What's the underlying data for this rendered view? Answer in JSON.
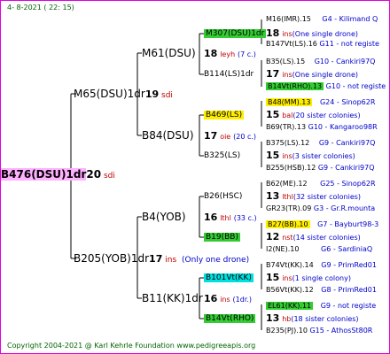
{
  "date": "4-  8-2021  ( 22:  15)",
  "copyright": "Copyright 2004-2021 @ Karl Kehrle Foundation   www.pedigreeapis.org",
  "root": {
    "label": "B476(DSU)1dr",
    "year": "20",
    "note": "sdi"
  },
  "gen1": [
    {
      "label": "M65(DSU)1dr",
      "year": "19",
      "note": "sdi"
    },
    {
      "label": "B205(YOB)1dr",
      "year": "17",
      "note": "ins",
      "extra": "(Only one drone)"
    }
  ],
  "gen2": [
    {
      "label": "M61(DSU)",
      "year": "18",
      "note": "leyh",
      "extra": "(7 c.)"
    },
    {
      "label": "B84(DSU)",
      "year": "17",
      "note": "oie",
      "extra": "(20 c.)"
    },
    {
      "label": "B4(YOB)",
      "year": "16",
      "note": "lthl",
      "extra": "(33 c.)"
    },
    {
      "label": "B11(KK)1dr",
      "year": "16",
      "note": "ins",
      "extra": "(1dr.)"
    }
  ],
  "gen3": [
    {
      "label": "M307(DSU)1dr",
      "year": "18",
      "note": "ins",
      "extra": "(One single drone)"
    },
    {
      "label": "B114(LS)1dr",
      "year": "17",
      "note": "ins",
      "extra": "(One single drone)"
    },
    {
      "label": "B469(LS)",
      "year": "15",
      "note": "bal",
      "extra": "(20 sister colonies)"
    },
    {
      "label": "B325(LS)",
      "year": "15",
      "note": "ins",
      "extra": "(3 sister colonies)"
    },
    {
      "label": "B26(HSC)",
      "year": "13",
      "note": "lthl",
      "extra": "(32 sister colonies)"
    },
    {
      "label": "B19(BB)",
      "year": "12",
      "note": "nst",
      "extra": "(14 sister colonies)"
    },
    {
      "label": "B101Vt(KK)",
      "year": "15",
      "note": "ins",
      "extra": "(1 single colony)"
    },
    {
      "label": "B14Vt(RHO)",
      "year": "13",
      "note": "hb",
      "extra": "(18 sister colonies)"
    }
  ],
  "gen4": [
    {
      "label": "M16(IMR).15",
      "ref": "G4 - Kilimand Q"
    },
    {
      "label": "B147Vt(LS).16",
      "ref": "G11 - not registe"
    },
    {
      "label": "B35(LS).15",
      "ref": "G10 - Cankiri97Q"
    },
    {
      "label": "B14Vt(RHO).13",
      "ref": "G10 - not registe"
    },
    {
      "label": "B48(MM).13",
      "ref": "G24 - Sinop62R"
    },
    {
      "label": "B69(TR).13",
      "ref": "G10 - Kangaroo98R"
    },
    {
      "label": "B375(LS).12",
      "ref": "G9 - Cankiri97Q"
    },
    {
      "label": "B255(HSB).12",
      "ref": "G9 - Cankiri97Q"
    },
    {
      "label": "B62(ME).12",
      "ref": "G25 - Sinop62R"
    },
    {
      "label": "GR23(TR).09",
      "ref": "G3 - Gr.R.mounta"
    },
    {
      "label": "B27(BB).10",
      "ref": "G7 - Bayburt98-3"
    },
    {
      "label": "I2(NE).10",
      "ref": "G6 - SardiniaQ"
    },
    {
      "label": "B74Vt(KK).14",
      "ref": "G9 - PrimRed01"
    },
    {
      "label": "B56Vt(KK).12",
      "ref": "G8 - PrimRed01"
    },
    {
      "label": "EL61(KK).11",
      "ref": "G9 - not registe"
    },
    {
      "label": "B235(PJ).10",
      "ref": "G15 - AthosSt80R"
    }
  ],
  "colors": {
    "frame": "#e000e0",
    "green": "#33cc33",
    "yellow": "#ffee00",
    "cyan": "#00e0e0",
    "red": "#c00000",
    "blue": "#0000cc",
    "date": "#006400"
  }
}
